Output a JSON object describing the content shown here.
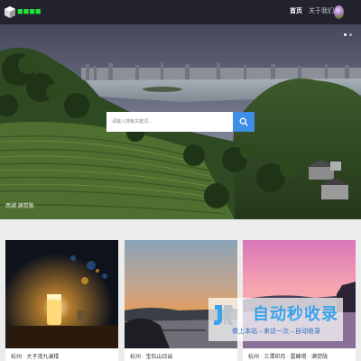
{
  "navbar": {
    "logo_text": "■■■■",
    "links": [
      {
        "label": "首页",
        "active": true
      },
      {
        "label": "关于我们",
        "active": false
      }
    ]
  },
  "hero": {
    "search_placeholder": "请输入搜索关键词...",
    "caption": "西湖 满觉陇",
    "carousel_dots": 2,
    "active_dot": 0
  },
  "cards": [
    {
      "title": "杭州 · 大子湾九澜楼"
    },
    {
      "title": "杭州 · 宝石山日出"
    },
    {
      "title": "杭州 · 三潭印月 · 雷峰塔 · 满觉陇"
    }
  ],
  "watermark": {
    "title": "自动秒收录",
    "subtitle": "做上本站→来访一次→自动收录"
  },
  "colors": {
    "navbar_bg": "#23232f",
    "logo_green": "#22e33a",
    "search_button": "#3e8ee8",
    "page_bg": "#ececec"
  }
}
